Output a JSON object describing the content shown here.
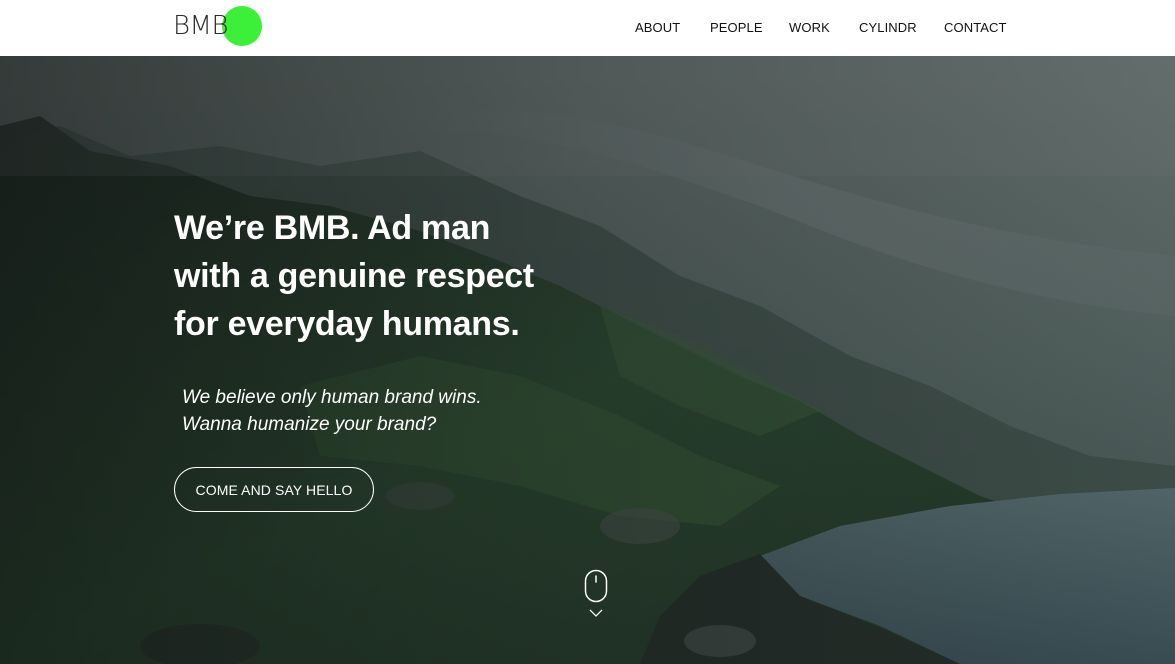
{
  "header": {
    "logo_text": "BMB",
    "nav": [
      {
        "label": "ABOUT"
      },
      {
        "label": "PEOPLE"
      },
      {
        "label": "WORK"
      },
      {
        "label": "CYLINDR"
      },
      {
        "label": "CONTACT"
      }
    ]
  },
  "hero": {
    "headline_lines": [
      "We’re BMB. Ad man",
      "with a genuine respect",
      "for everyday humans."
    ],
    "subtext_lines": [
      "We believe only human brand wins.",
      "Wanna humanize your brand?"
    ],
    "cta_label": "COME AND SAY HELLO"
  },
  "colors": {
    "brand_green": "#3cf03a",
    "header_bg": "#ffffff",
    "text_light": "#ffffff"
  },
  "icons": {
    "logo_dot": "green-circle",
    "scroll": "mouse-scroll-icon",
    "chevron": "chevron-down-icon"
  }
}
